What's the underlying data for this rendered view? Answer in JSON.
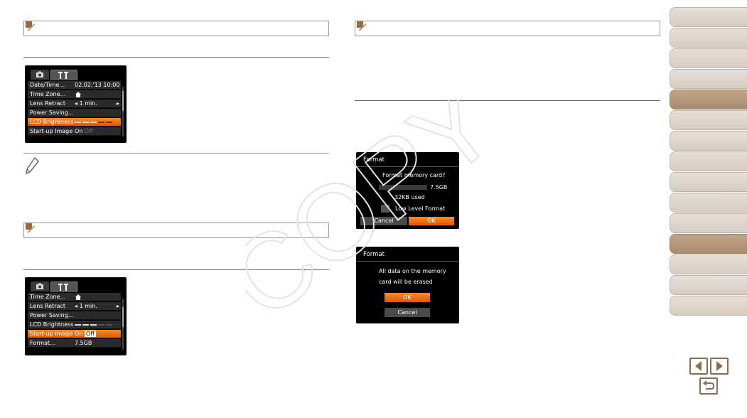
{
  "left": {
    "menu1": {
      "rows": [
        {
          "label": "Date/Time",
          "value": "02.02.'13 10:00"
        },
        {
          "label": "Time Zone",
          "value": ""
        },
        {
          "label": "Lens Retract",
          "value": "1 min."
        },
        {
          "label": "Power Saving",
          "value": ""
        },
        {
          "label": "LCD Brightness",
          "value": ""
        },
        {
          "label": "Start-up Image",
          "on": "On",
          "off": "Off"
        }
      ]
    },
    "menu2": {
      "rows": [
        {
          "label": "Time Zone",
          "value": ""
        },
        {
          "label": "Lens Retract",
          "value": "1 min."
        },
        {
          "label": "Power Saving",
          "value": ""
        },
        {
          "label": "LCD Brightness",
          "value": ""
        },
        {
          "label": "Start-up Image",
          "on": "On",
          "off": "Off"
        },
        {
          "label": "Format",
          "value": "7.5GB"
        }
      ]
    }
  },
  "right": {
    "dialog1": {
      "title": "Format",
      "question": "Format memory card?",
      "capacity": "7.5GB",
      "used": "32KB used",
      "checkbox_label": "Low Level Format",
      "cancel": "Cancel",
      "ok": "OK"
    },
    "dialog2": {
      "title": "Format",
      "line1": "All data on the memory",
      "line2": "card will be erased",
      "ok": "OK",
      "cancel": "Cancel"
    }
  },
  "watermark": "COPY",
  "colors": {
    "accent_brown": "#9a6a3f",
    "orange_select": "#e86e10",
    "nav_active": "#b09176"
  },
  "nav": {
    "tab_count": 14,
    "active_tabs": [
      4,
      11
    ],
    "prev_icon": "arrow-left-icon",
    "next_icon": "arrow-right-icon",
    "return_icon": "return-icon"
  }
}
